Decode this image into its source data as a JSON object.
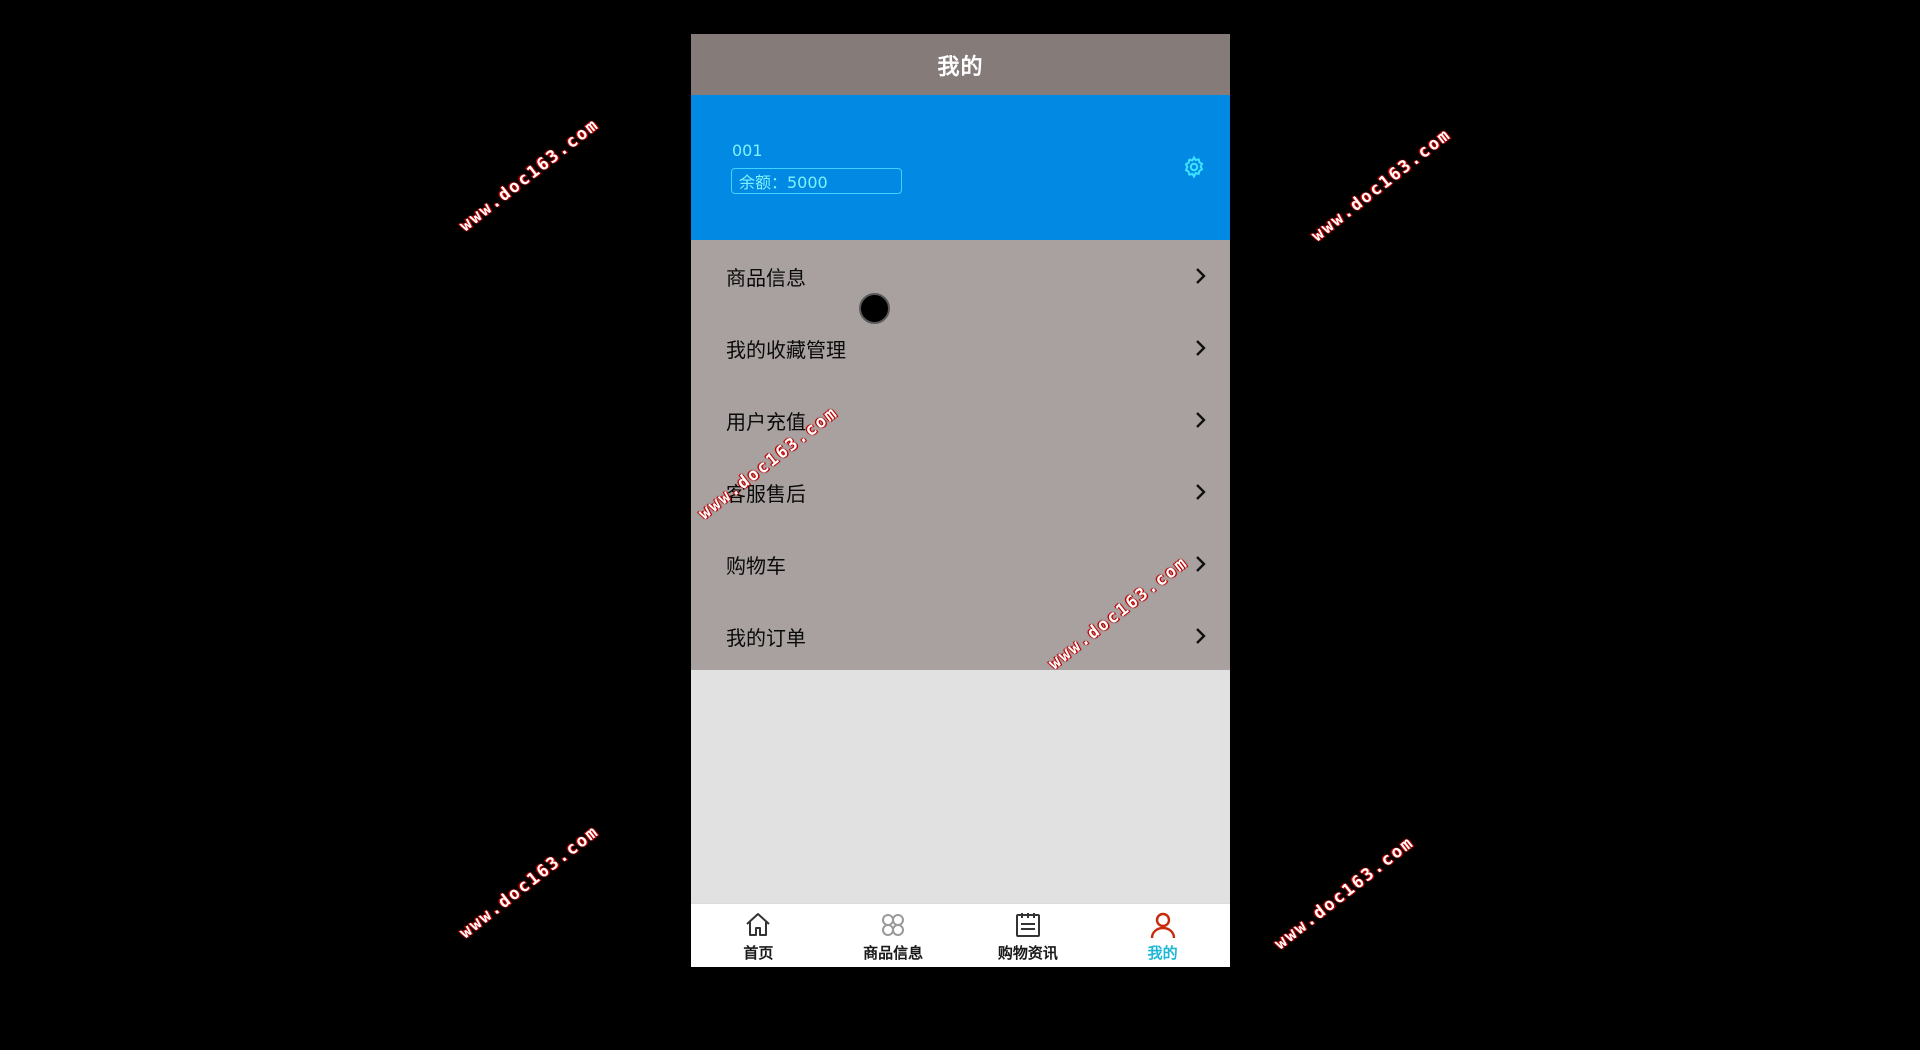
{
  "header": {
    "title": "我的"
  },
  "profile": {
    "username": "001",
    "balance": "余额：5000",
    "settings_icon": "gear-icon",
    "accent_color": "#0189e4"
  },
  "menu": {
    "items": [
      {
        "label": "商品信息",
        "icon": "chevron-right-icon"
      },
      {
        "label": "我的收藏管理",
        "icon": "chevron-right-icon"
      },
      {
        "label": "用户充值",
        "icon": "chevron-right-icon"
      },
      {
        "label": "客服售后",
        "icon": "chevron-right-icon"
      },
      {
        "label": "购物车",
        "icon": "chevron-right-icon"
      },
      {
        "label": "我的订单",
        "icon": "chevron-right-icon"
      }
    ]
  },
  "tabbar": {
    "tabs": [
      {
        "label": "首页",
        "icon": "home-icon",
        "active": false
      },
      {
        "label": "商品信息",
        "icon": "clover-icon",
        "active": false
      },
      {
        "label": "购物资讯",
        "icon": "news-icon",
        "active": false
      },
      {
        "label": "我的",
        "icon": "user-icon",
        "active": true
      }
    ],
    "active_color": "#1fb7d6",
    "active_icon_color": "#c62a0a"
  },
  "watermark": {
    "text": "www.doc163.com"
  }
}
